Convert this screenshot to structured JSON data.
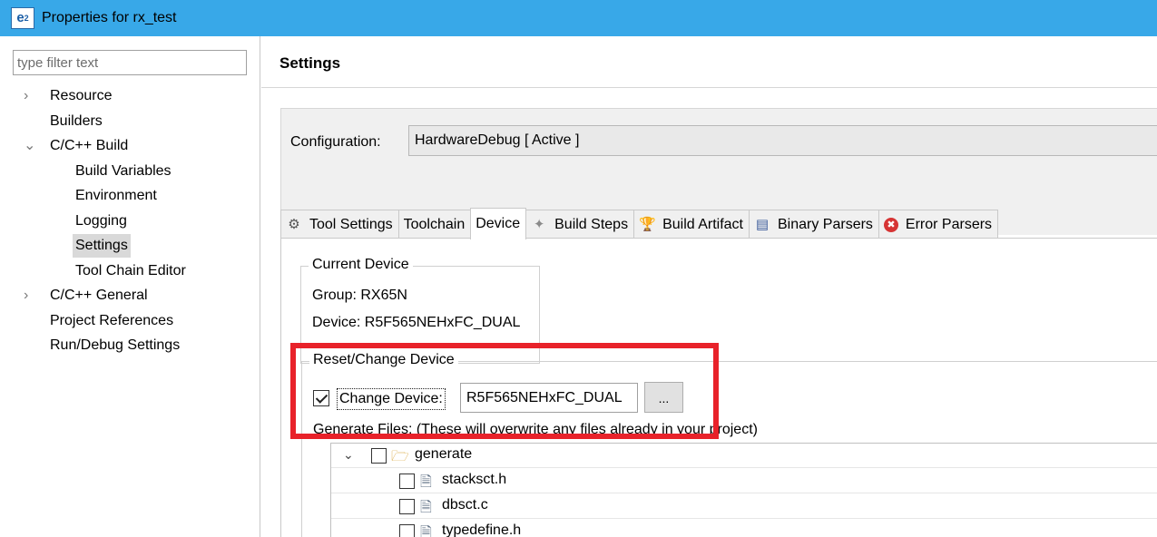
{
  "window": {
    "title": "Properties for rx_test",
    "app_logo_text": "e",
    "app_logo_sup": "2"
  },
  "left": {
    "filter_placeholder": "type filter text",
    "tree": [
      {
        "label": "Resource",
        "chevron": "›",
        "level": 0
      },
      {
        "label": "Builders",
        "chevron": "",
        "level": 0
      },
      {
        "label": "C/C++ Build",
        "chevron": "⌄",
        "level": 0
      },
      {
        "label": "Build Variables",
        "chevron": "",
        "level": 1
      },
      {
        "label": "Environment",
        "chevron": "",
        "level": 1
      },
      {
        "label": "Logging",
        "chevron": "",
        "level": 1
      },
      {
        "label": "Settings",
        "chevron": "",
        "level": 1,
        "selected": true
      },
      {
        "label": "Tool Chain Editor",
        "chevron": "",
        "level": 1
      },
      {
        "label": "C/C++ General",
        "chevron": "›",
        "level": 0
      },
      {
        "label": "Project References",
        "chevron": "",
        "level": 0
      },
      {
        "label": "Run/Debug Settings",
        "chevron": "",
        "level": 0
      }
    ]
  },
  "main": {
    "title": "Settings",
    "configuration_label": "Configuration:",
    "configuration_value": "HardwareDebug  [ Active ]",
    "tabs": [
      {
        "label": "Tool Settings",
        "icon": "tool-settings-icon"
      },
      {
        "label": "Toolchain",
        "icon": ""
      },
      {
        "label": "Device",
        "icon": "",
        "active": true
      },
      {
        "label": "Build Steps",
        "icon": "build-steps-icon"
      },
      {
        "label": "Build Artifact",
        "icon": "build-artifact-icon"
      },
      {
        "label": "Binary Parsers",
        "icon": "binary-parsers-icon"
      },
      {
        "label": "Error Parsers",
        "icon": "error-parsers-icon"
      }
    ],
    "current_device": {
      "legend": "Current Device",
      "group_line": "Group:  RX65N",
      "device_line": "Device:  R5F565NEHxFC_DUAL"
    },
    "reset_change": {
      "legend": "Reset/Change Device",
      "checkbox_label": "Change Device:",
      "checked": true,
      "device_value": "R5F565NEHxFC_DUAL",
      "browse_label": "...",
      "generate_label": "Generate Files: (These will overwrite any files already in your project)"
    },
    "files": [
      {
        "label": "generate",
        "type": "folder",
        "expanded": true
      },
      {
        "label": "stacksct.h",
        "type": "file"
      },
      {
        "label": "dbsct.c",
        "type": "file"
      },
      {
        "label": "typedefine.h",
        "type": "file"
      }
    ]
  },
  "colors": {
    "titlebar": "#38a8e8",
    "highlight": "#e8222a",
    "selected_bg": "#d9d9d9"
  }
}
